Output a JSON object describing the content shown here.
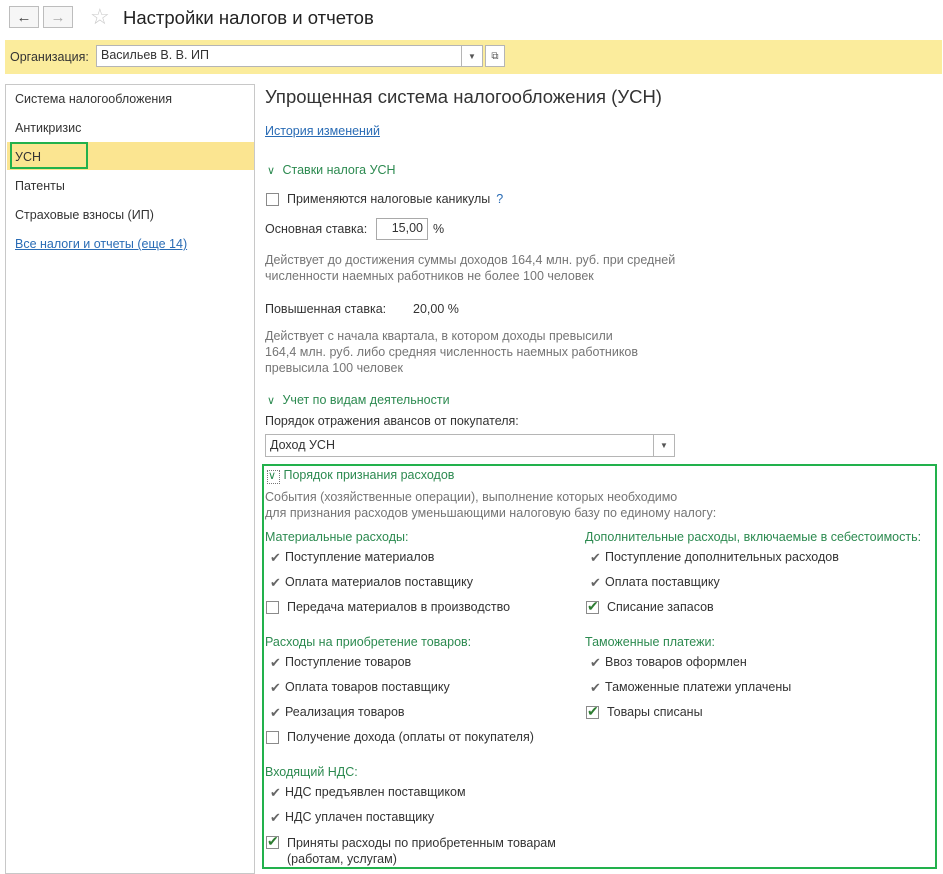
{
  "window": {
    "title": "Настройки налогов и отчетов",
    "back_icon": "←",
    "forward_icon": "→"
  },
  "org": {
    "label": "Организация:",
    "value": "Васильев В. В. ИП"
  },
  "sidebar": {
    "items": [
      "Система налогообложения",
      "Антикризис",
      "УСН",
      "Патенты",
      "Страховые взносы (ИП)"
    ],
    "more_link": "Все налоги и отчеты (еще 14)"
  },
  "main": {
    "heading": "Упрощенная система налогообложения (УСН)",
    "history_link": "История изменений",
    "rates": {
      "section": "Ставки налога УСН",
      "holidays_label": "Применяются налоговые каникулы",
      "holidays_help": "?",
      "base_label": "Основная ставка:",
      "base_value": "15,00",
      "percent": "%",
      "base_note_1": "Действует до достижения суммы доходов 164,4 млн. руб. при средней",
      "base_note_2": "численности наемных работников не более 100 человек",
      "raised_label": "Повышенная ставка:",
      "raised_value": "20,00 %",
      "raised_note_1": "Действует с начала квартала, в котором доходы превысили",
      "raised_note_2": "164,4 млн. руб. либо средняя численность наемных работников",
      "raised_note_3": "превысила 100 человек"
    },
    "activity": {
      "section": "Учет по видам деятельности",
      "advance_label": "Порядок отражения авансов от покупателя:",
      "advance_value": "Доход УСН"
    },
    "expenses": {
      "section": "Порядок признания расходов",
      "desc_1": "События (хозяйственные операции), выполнение которых необходимо",
      "desc_2": "для признания расходов уменьшающими налоговую базу по единому налогу:",
      "material": {
        "title": "Материальные расходы:",
        "i1": "Поступление материалов",
        "i2": "Оплата материалов поставщику",
        "i3": "Передача материалов в производство"
      },
      "additional": {
        "title": "Дополнительные расходы, включаемые в себестоимость:",
        "i1": "Поступление дополнительных расходов",
        "i2": "Оплата поставщику",
        "i3": "Списание запасов"
      },
      "goods": {
        "title": "Расходы на приобретение товаров:",
        "i1": "Поступление товаров",
        "i2": "Оплата товаров поставщику",
        "i3": "Реализация товаров",
        "i4": "Получение дохода (оплаты от покупателя)"
      },
      "customs": {
        "title": "Таможенные платежи:",
        "i1": "Ввоз товаров оформлен",
        "i2": "Таможенные платежи уплачены",
        "i3": "Товары списаны"
      },
      "vat": {
        "title": "Входящий НДС:",
        "i1": "НДС предъявлен поставщиком",
        "i2": "НДС уплачен поставщику",
        "i3a": "Приняты расходы по приобретенным товарам",
        "i3b": "(работам, услугам)"
      }
    }
  },
  "colors": {
    "accent_green": "#22b14c",
    "org_bar": "#fbec9c",
    "selected": "#fbe591",
    "link": "#2a6cb5"
  }
}
